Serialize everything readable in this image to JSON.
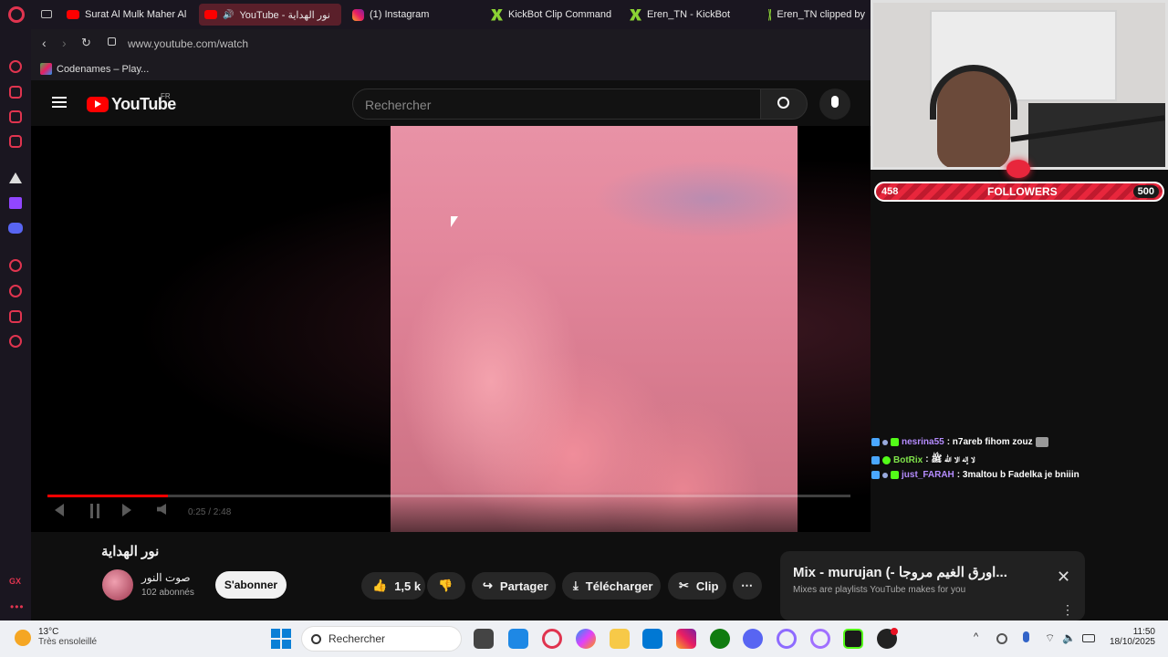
{
  "tabs": [
    {
      "label": "Surat Al Mulk Maher Al I",
      "icon": "youtube-icon",
      "active": false
    },
    {
      "label": "YouTube - نور الهداية",
      "icon": "youtube-icon",
      "active": true
    },
    {
      "label": "(1) Instagram",
      "icon": "instagram-icon",
      "active": false
    },
    {
      "label": "KickBot Clip Command",
      "icon": "kick-icon",
      "active": false
    },
    {
      "label": "Eren_TN - KickBot",
      "icon": "kick-icon",
      "active": false
    },
    {
      "label": "Eren_TN clipped by",
      "icon": "kick-icon",
      "active": false
    }
  ],
  "address": {
    "url": "www.youtube.com/watch"
  },
  "bookmarks": [
    {
      "label": "Codenames – Play..."
    }
  ],
  "youtube": {
    "logo": "YouTube",
    "region": "FR",
    "search_placeholder": "Rechercher"
  },
  "player": {
    "time": "0:25 / 2:48",
    "progress": 0.15
  },
  "video": {
    "title": "نور الهداية",
    "channel": "صوت النور",
    "subscribers": "102 abonnés",
    "subscribe_label": "S'abonner",
    "likes": "1,5 k",
    "share_label": "Partager",
    "download_label": "Télécharger",
    "clip_label": "Clip"
  },
  "mix": {
    "title": "Mix - murujan (- اورق الغيم مروجا...",
    "subtitle": "Mixes are playlists YouTube makes for you"
  },
  "overlay": {
    "followers_current": "458",
    "followers_label": "FOLLOWERS",
    "followers_goal": "500",
    "chat": [
      {
        "user": "nesrina55",
        "message": ": n7areb fihom zouz",
        "color": "#b58cff"
      },
      {
        "user": "BotRix",
        "message": ": لا إله الا الله ﷺ",
        "color": "#7fe34a"
      },
      {
        "user": "just_FARAH",
        "message": ": 3maltou b Fadelka je bniiin",
        "color": "#b58cff"
      }
    ]
  },
  "taskbar": {
    "weather_temp": "13°C",
    "weather_desc": "Très ensoleillé",
    "search_label": "Rechercher",
    "time": "11:50",
    "date": "18/10/2025"
  },
  "opera_sidebar": {
    "bottom_label": "GX"
  },
  "colors": {
    "accent": "#ff0000",
    "opera_red": "#e0344f",
    "followers_bar": "#e8263c"
  }
}
